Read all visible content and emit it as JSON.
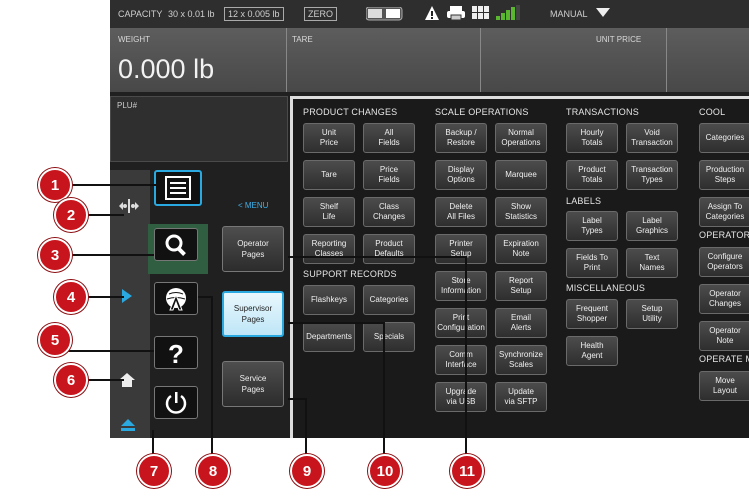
{
  "status": {
    "capacity_label": "CAPACITY",
    "capacity_1": "30 x 0.01 lb",
    "capacity_2": "12 x 0.005 lb",
    "zero": "ZERO",
    "mode": "MANUAL"
  },
  "readouts": {
    "weight_label": "WEIGHT",
    "weight_value": "0.000 lb",
    "tare_label": "TARE",
    "unit_price_label": "UNIT PRICE"
  },
  "plu_label": "PLU#",
  "menu_link": "< MENU",
  "page_buttons": {
    "operator": "Operator\nPages",
    "supervisor": "Supervisor\nPages",
    "service": "Service\nPages"
  },
  "sections": {
    "product_changes": {
      "title": "PRODUCT CHANGES",
      "buttons": [
        "Unit\nPrice",
        "All\nFields",
        "Tare",
        "Price\nFields",
        "Shelf\nLife",
        "Class\nChanges",
        "Reporting\nClasses",
        "Product\nDefaults"
      ]
    },
    "support_records": {
      "title": "SUPPORT RECORDS",
      "buttons": [
        "Flashkeys",
        "Categories",
        "Departments",
        "Specials"
      ]
    },
    "scale_operations": {
      "title": "SCALE OPERATIONS",
      "buttons": [
        "Backup /\nRestore",
        "Normal\nOperations",
        "Display\nOptions",
        "Marquee",
        "Delete\nAll Files",
        "Show\nStatistics",
        "Printer\nSetup",
        "Expiration\nNote",
        "Store\nInformation",
        "Report\nSetup",
        "Print\nConfiguration",
        "Email\nAlerts",
        "Comm\nInterface",
        "Synchronize\nScales",
        "Upgrade\nvia USB",
        "Update\nvia SFTP"
      ]
    },
    "transactions": {
      "title": "TRANSACTIONS",
      "buttons": [
        "Hourly\nTotals",
        "Void\nTransaction",
        "Product\nTotals",
        "Transaction\nTypes"
      ]
    },
    "labels": {
      "title": "LABELS",
      "buttons": [
        "Label\nTypes",
        "Label\nGraphics",
        "Fields To\nPrint",
        "Text\nNames"
      ]
    },
    "miscellaneous": {
      "title": "MISCELLANEOUS",
      "buttons": [
        "Frequent\nShopper",
        "Setup\nUtility",
        "Health\nAgent"
      ]
    },
    "cool": {
      "title": "COOL",
      "buttons": [
        "Categories",
        "Production\nSteps",
        "Assign To\nCategories"
      ]
    },
    "operator": {
      "title": "OPERATOR",
      "buttons": [
        "Configure\nOperators",
        "Operator\nChanges",
        "Operator\nNote"
      ]
    },
    "operate": {
      "title": "OPERATE M",
      "buttons": [
        "Move\nLayout"
      ]
    }
  },
  "callouts": [
    "1",
    "2",
    "3",
    "4",
    "5",
    "6",
    "7",
    "8",
    "9",
    "10",
    "11"
  ],
  "colors": {
    "callout_red": "#c8141c",
    "screen_bg": "#202020",
    "highlight_blue": "#2aa8e0",
    "menu_link_blue": "#3fb1ea"
  }
}
